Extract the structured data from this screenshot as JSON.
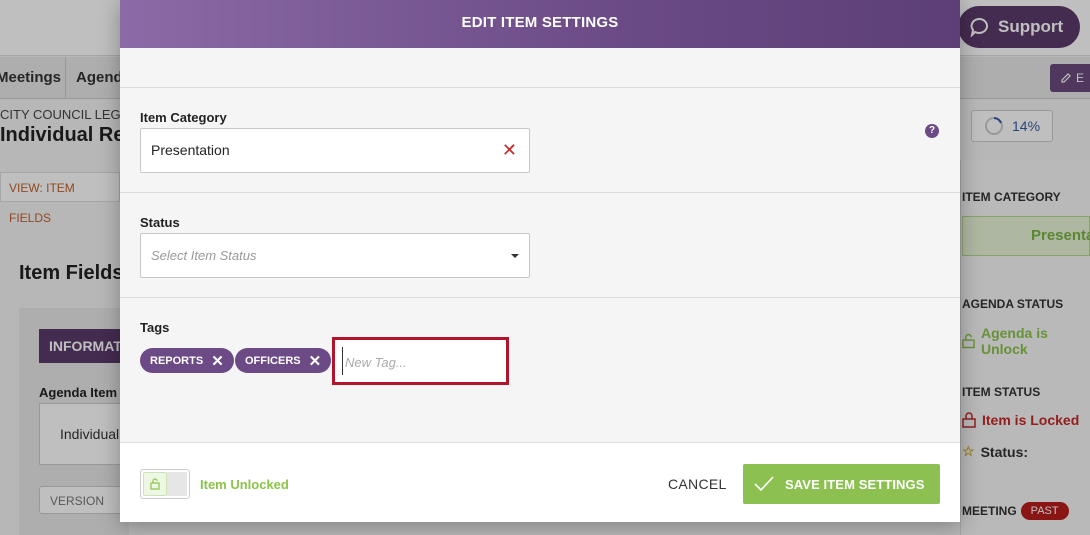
{
  "background": {
    "support_label": "Support",
    "nav": [
      "Meetings",
      "Agenda"
    ],
    "edit_label": "E",
    "breadcrumb": "CITY COUNCIL LEGI",
    "title": "Individual Rep",
    "progress": "14%",
    "view_link": "VIEW: ITEM FIELDS",
    "item_fields_title": "Item Fields",
    "info_tab": "INFORMAT",
    "agenda_item_label": "Agenda Item",
    "agenda_item_value": "Individual",
    "version_label": "VERSION",
    "right_panel": {
      "item_category_label": "ITEM CATEGORY",
      "item_category_value": "Presenta",
      "agenda_status_label": "AGENDA STATUS",
      "agenda_status_value": "Agenda is Unlock",
      "item_status_label": "ITEM STATUS",
      "item_status_value": "Item is Locked",
      "status_label": "Status:",
      "meeting_label": "MEETING",
      "past_badge": "PAST"
    }
  },
  "modal": {
    "title": "EDIT ITEM SETTINGS",
    "item_category": {
      "label": "Item Category",
      "value": "Presentation"
    },
    "status": {
      "label": "Status",
      "placeholder": "Select Item Status"
    },
    "tags": {
      "label": "Tags",
      "items": [
        "REPORTS",
        "OFFICERS"
      ],
      "input_placeholder": "New Tag..."
    },
    "footer": {
      "toggle_label": "Item Unlocked",
      "cancel_label": "CANCEL",
      "save_label": "SAVE ITEM SETTINGS"
    }
  },
  "colors": {
    "header_purple": "#6b4a85",
    "save_green": "#8cc152",
    "unlocked_green": "#8bc34a",
    "highlight_red": "#b0152b",
    "locked_red": "#c62828"
  }
}
